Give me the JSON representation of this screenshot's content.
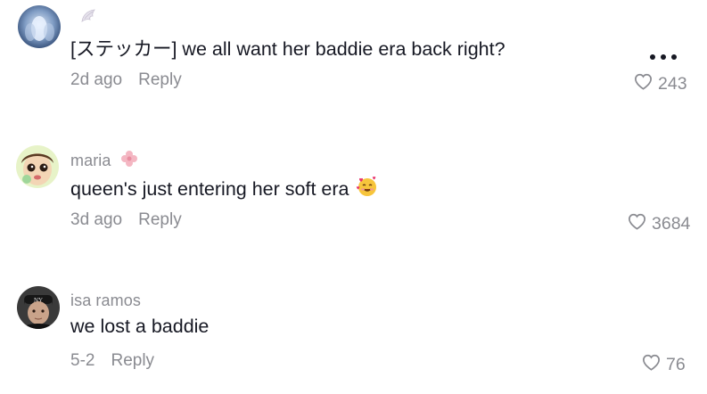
{
  "comments": [
    {
      "username": "",
      "username_badge_icon": "angel-wing-icon",
      "text": "[ステッカー] we all want her baddie era back right?",
      "timestamp": "2d ago",
      "reply_label": "Reply",
      "likes": "243",
      "more_icon": "more-options-icon"
    },
    {
      "username": "maria",
      "username_badge_icon": "pink-flower-icon",
      "text": "queen's just entering her soft era",
      "text_emoji": "smiling-face-with-hearts-icon",
      "timestamp": "3d ago",
      "reply_label": "Reply",
      "likes": "3684"
    },
    {
      "username": "isa ramos",
      "text": "we lost a baddie",
      "timestamp": "5-2",
      "reply_label": "Reply",
      "likes": "76"
    }
  ],
  "colors": {
    "primary_text": "#161823",
    "secondary_text": "#8a8b91",
    "background": "#ffffff"
  }
}
